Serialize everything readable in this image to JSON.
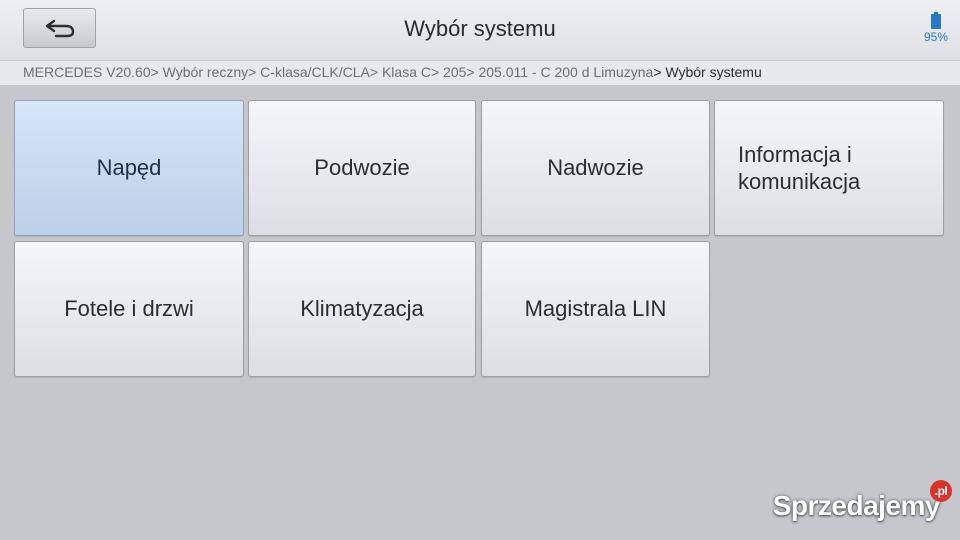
{
  "header": {
    "title": "Wybór systemu",
    "battery_percent": "95%"
  },
  "breadcrumb": {
    "path": "MERCEDES V20.60> Wybór reczny> C-klasa/CLK/CLA> Klasa C> 205> 205.011 - C 200 d Limuzyna",
    "current": "> Wybór systemu"
  },
  "systems": [
    {
      "label": "Napęd",
      "selected": true
    },
    {
      "label": "Podwozie"
    },
    {
      "label": "Nadwozie"
    },
    {
      "label": "Informacja i komunikacja"
    },
    {
      "label": "Fotele i drzwi"
    },
    {
      "label": "Klimatyzacja"
    },
    {
      "label": "Magistrala LIN"
    }
  ],
  "watermark": {
    "text": "Sprzedajemy",
    "suffix": ".pl"
  },
  "colors": {
    "selected_tile": "#c8dbf0",
    "accent_battery": "#2a78c8"
  }
}
